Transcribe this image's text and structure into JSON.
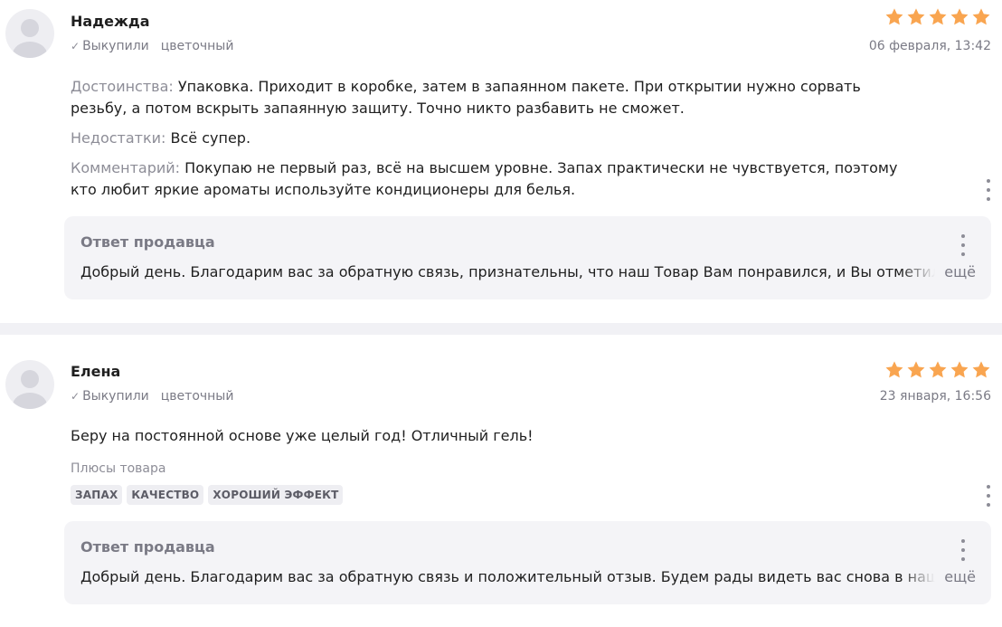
{
  "reviews": [
    {
      "author": "Надежда",
      "purchased": "Выкупили",
      "variant": "цветочный",
      "date": "06 февраля, 13:42",
      "rating": 5,
      "pros_label": "Достоинства:",
      "pros_text": "Упаковка. Приходит в коробке, затем в запаянном пакете. При открытии нужно сорвать резьбу, а потом вскрыть запаянную защиту. Точно никто разбавить не сможет.",
      "cons_label": "Недостатки:",
      "cons_text": "Всё супер.",
      "comment_label": "Комментарий:",
      "comment_text": "Покупаю не первый раз, всё на высшем уровне. Запах практически не чувствуется, поэтому кто любит яркие ароматы используйте кондиционеры для белья.",
      "reply": {
        "title": "Ответ продавца",
        "text": "Добрый день. Благодарим вас за обратную связь, признательны, что наш Товар Вам понравился, и Вы отметили его",
        "more": "ещё"
      }
    },
    {
      "author": "Елена",
      "purchased": "Выкупили",
      "variant": "цветочный",
      "date": "23 января, 16:56",
      "rating": 5,
      "text": "Беру на постоянной основе уже целый год! Отличный гель!",
      "pros_label": "Плюсы товара",
      "tags": [
        "ЗАПАХ",
        "КАЧЕСТВО",
        "ХОРОШИЙ ЭФФЕКТ"
      ],
      "reply": {
        "title": "Ответ продавца",
        "text": "Добрый день. Благодарим вас за обратную связь и положительный отзыв. Будем рады видеть вас снова в нашем",
        "more": "ещё"
      }
    }
  ],
  "colors": {
    "star": "#f9a550",
    "muted_text": "#7a7a85",
    "reply_bg": "#f4f4f7",
    "divider": "#f1f1f5"
  }
}
